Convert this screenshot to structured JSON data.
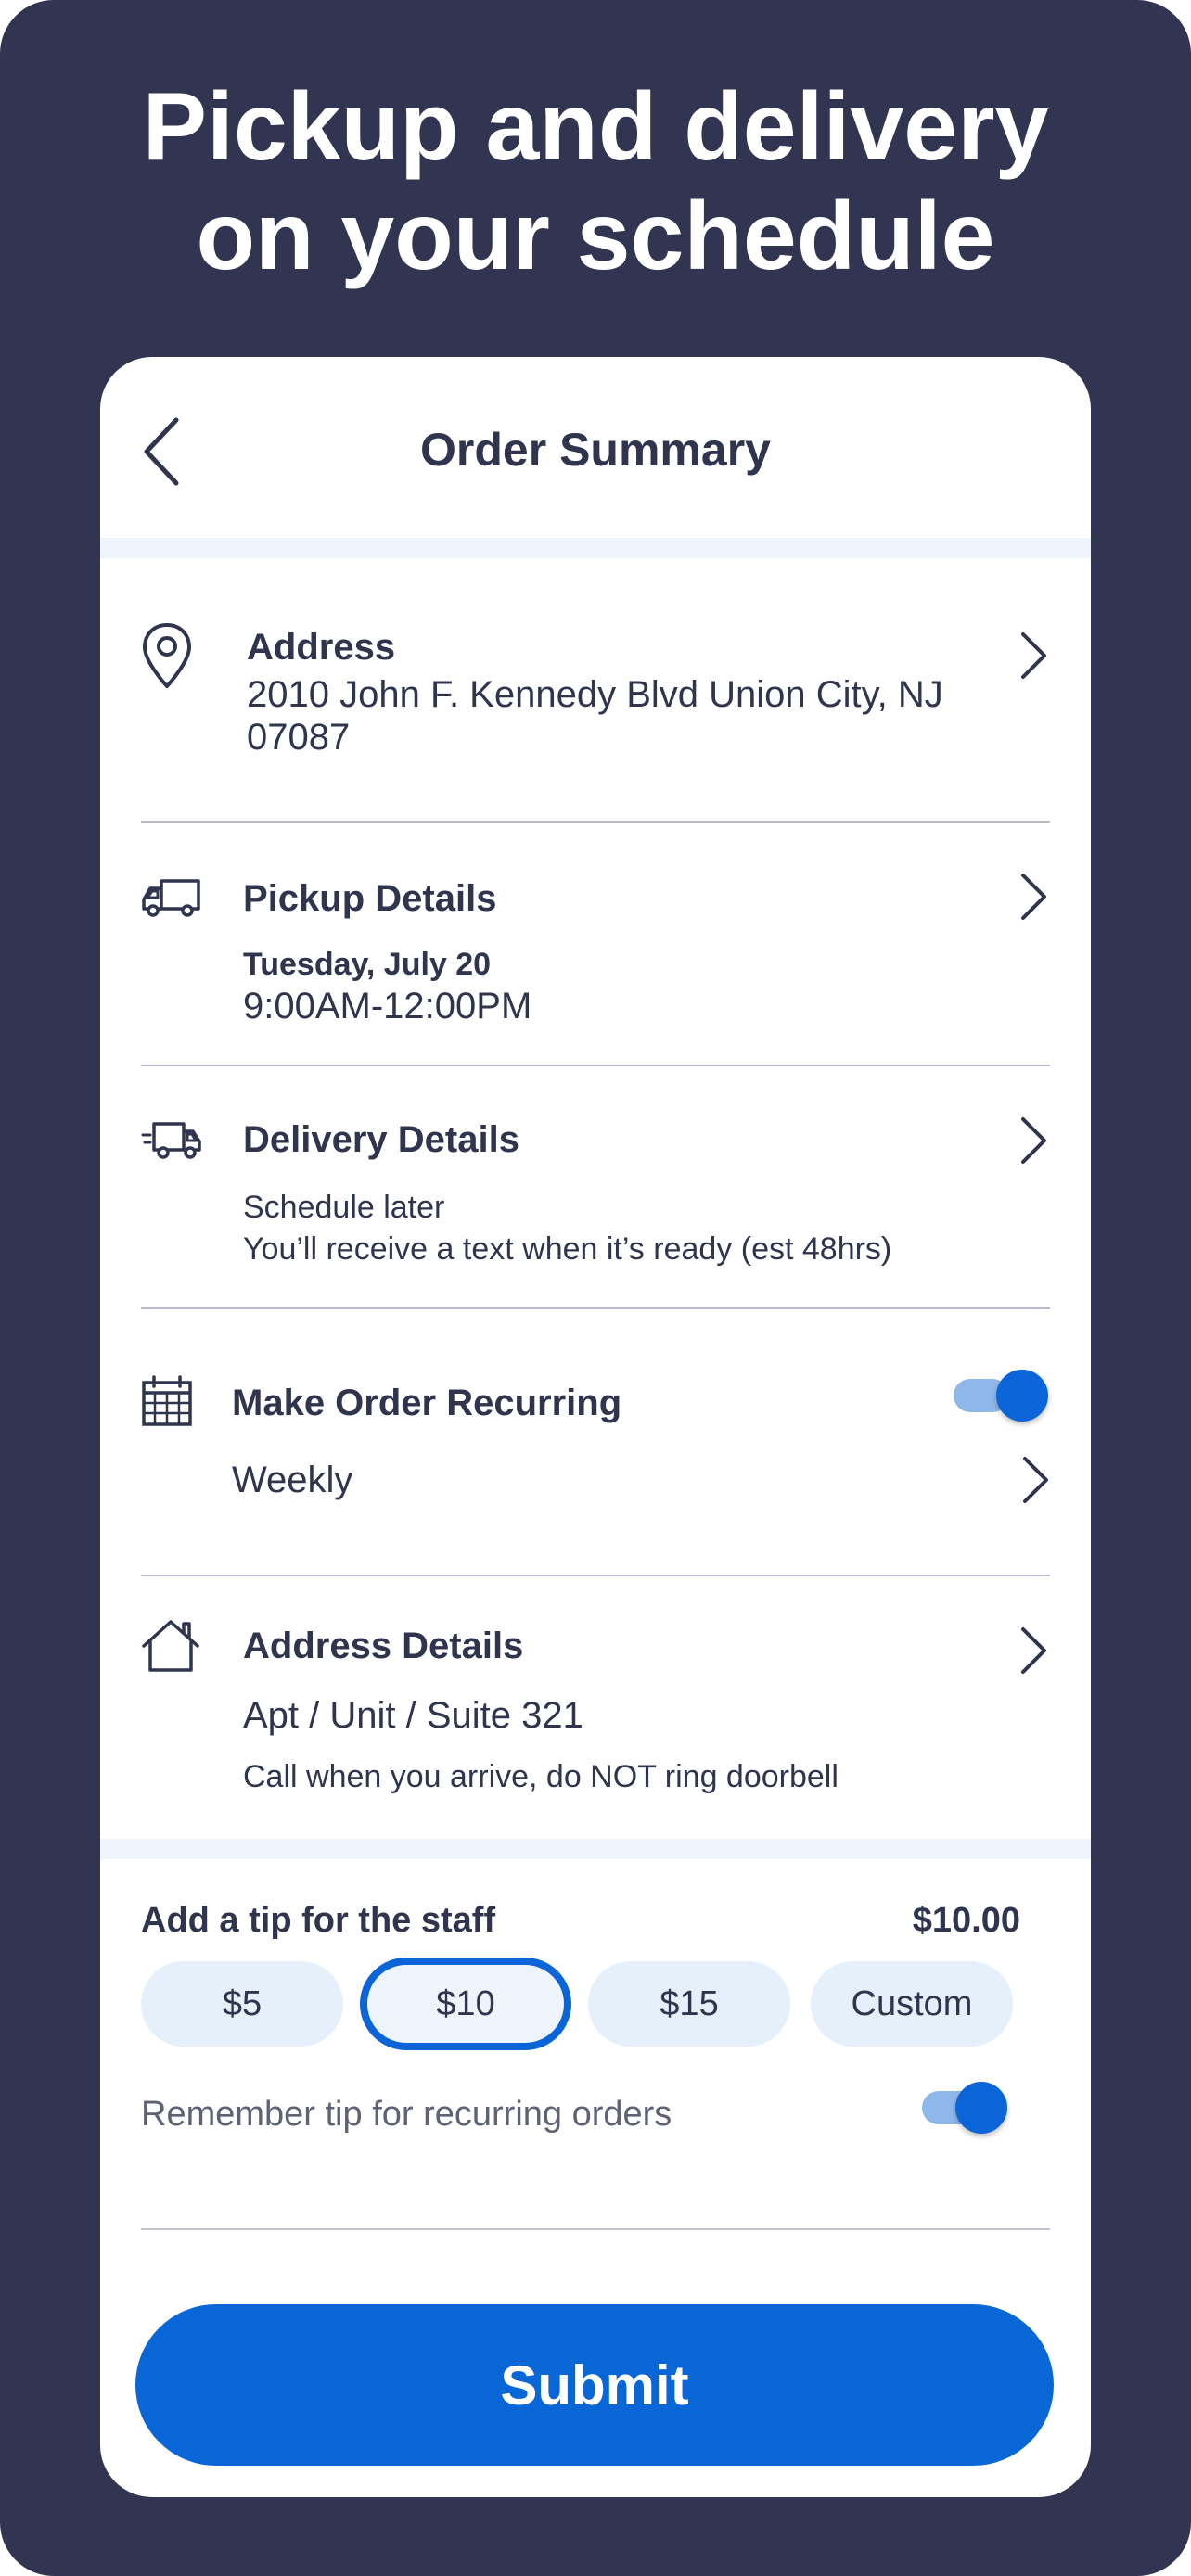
{
  "headline": {
    "line1": "Pickup and delivery",
    "line2": "on your schedule"
  },
  "header": {
    "title": "Order Summary",
    "back_icon": "chevron-left-icon"
  },
  "address": {
    "icon": "map-pin-icon",
    "title": "Address",
    "line1": "2010 John F. Kennedy Blvd Union City, NJ",
    "line2": "07087"
  },
  "pickup": {
    "icon": "truck-icon",
    "title": "Pickup Details",
    "date": "Tuesday, July 20",
    "time": "9:00AM-12:00PM"
  },
  "delivery": {
    "icon": "delivery-truck-icon",
    "title": "Delivery Details",
    "status": "Schedule later",
    "note": "You’ll receive a text when it’s ready (est 48hrs)"
  },
  "recurring": {
    "icon": "calendar-icon",
    "title": "Make Order Recurring",
    "enabled": true,
    "frequency": "Weekly"
  },
  "address_details": {
    "icon": "house-icon",
    "title": "Address Details",
    "unit": "Apt / Unit / Suite 321",
    "instructions": "Call when you arrive, do NOT ring doorbell"
  },
  "tip": {
    "label": "Add a tip for the staff",
    "amount": "$10.00",
    "options": [
      "$5",
      "$10",
      "$15",
      "Custom"
    ],
    "selected": "$10",
    "remember_label": "Remember tip for recurring orders",
    "remember_enabled": true
  },
  "submit_label": "Submit",
  "colors": {
    "background": "#313551",
    "accent": "#0866d6",
    "text": "#30344d",
    "chip": "#e6f0fb"
  }
}
